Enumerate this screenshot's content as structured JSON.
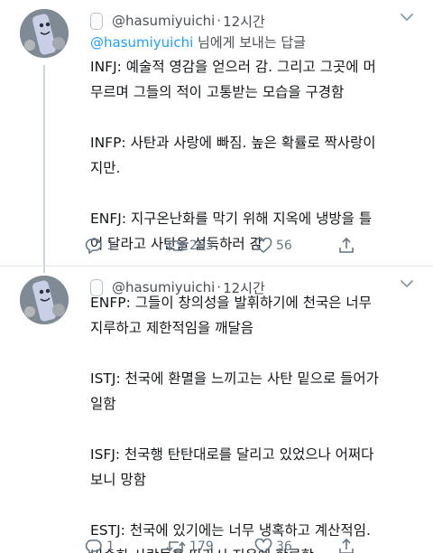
{
  "tweets": [
    {
      "handle": "@hasumiyuichi",
      "dot": "·",
      "time": "12시간",
      "reply_prefix": "@hasumiyuichi",
      "reply_suffix": " 님에게 보내는 답글",
      "paragraphs": [
        [
          "INFJ: 예술적 영감을 얻으러 감. 그리고 그곳에 머",
          "무르며 그들의 적이 고통받는 모습을 구경함"
        ],
        [
          "INFP: 사탄과 사랑에 빠짐. 높은 확률로 짝사랑이",
          "지만."
        ],
        [
          "ENFJ: 지구온난화를 막기 위해 지옥에 냉방을 틀",
          "어 달라고 사탄을 설득하러 감"
        ]
      ],
      "actions": {
        "replies": "1",
        "retweets": "283",
        "likes": "56"
      }
    },
    {
      "handle": "@hasumiyuichi",
      "dot": "·",
      "time": "12시간",
      "paragraphs": [
        [
          "ENFP: 그들이 창의성을 발휘하기에 천국은 너무",
          "지루하고 제한적임을 깨달음"
        ],
        [
          "ISTJ: 천국에 환멸을 느끼고는 사탄 밑으로 들어가",
          "일함"
        ],
        [
          "ISFJ: 천국행 탄탄대로를 달리고 있었으나 어쩌다",
          "보니 망함"
        ],
        [
          "ESTJ: 천국에 있기에는 너무 냉혹하고 계산적임.",
          "비슷한 사람들을 따라서 지옥에 합류함"
        ]
      ],
      "actions": {
        "replies": "1",
        "retweets": "179",
        "likes": "36"
      }
    }
  ],
  "colors": {
    "link": "#1da1f2",
    "muted": "#657786",
    "text": "#14171a"
  }
}
